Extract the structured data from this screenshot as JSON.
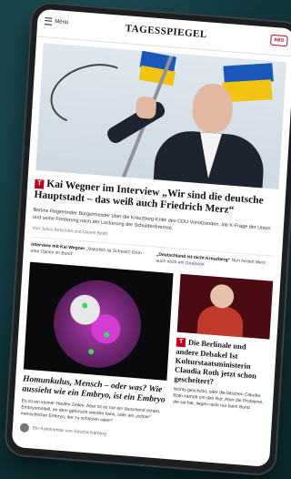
{
  "header": {
    "menu_label": "Menü",
    "logo": "TAGESSPIEGEL",
    "abo_label": "ABO"
  },
  "lead": {
    "tag": "Ⓣ",
    "headline": "Kai Wegner im Interview „Wir sind die deutsche Hauptstadt – das weiß auch Friedrich Merz“",
    "teaser": "Berlins Regierender Bürgermeister über die Kreuzberg-Kritik des CDU-Vorsitzenden, die K-Frage der Union und seine Forderung nach der Lockerung der Schuldenbremse.",
    "byline": "Von Julius Betschka und Daniel Böldt"
  },
  "related": [
    {
      "bold": "Interview mit Kai Wegner",
      "text": "„Natürlich ist Schwarz-Grün eine Option im Bund“"
    },
    {
      "bold": "„Deutschland ist nicht Kreuzberg“",
      "text": "Nun fordert Merz auch noch ein Grußwort"
    }
  ],
  "story2": {
    "headline": "Homunkulus, Mensch – oder was? Wie aussieht wie ein Embryo, ist ein Embryo",
    "teaser": "Es ist ein kleiner Haufen Zellen. Aber ist es nur ein täuschend echtes Embryomodell, an dem geforscht werden kann, oder ein „echter“ menschlicher Embryo, der zu schützen wäre?",
    "author": "Ein Kommentar von Sascha Karberg"
  },
  "story3": {
    "tag": "Ⓣ",
    "headline": "Die Berlinale und andere Debakel Ist Kulturstaatsministerin Claudia Roth jetzt schon gescheitert?",
    "teaser": "Nichts geschickt, oder die falschen Claudia Roth kämpft um den Ruf. Aber die Probleme, die sie hat, liegen nicht nur beim Bund."
  }
}
